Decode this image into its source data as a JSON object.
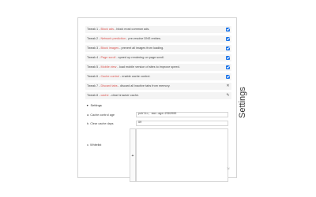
{
  "tweaks": [
    {
      "prefix": "Tweak 1 - ",
      "name": "Block ads",
      "desc": " - block most common ads.",
      "control": "checkbox",
      "checked": true
    },
    {
      "prefix": "Tweak 2 - ",
      "name": "Network prediction",
      "desc": " - pre-resolve DNS entries.",
      "control": "checkbox",
      "checked": true
    },
    {
      "prefix": "Tweak 3 - ",
      "name": "Block images",
      "desc": " - prevent all images from loading.",
      "control": "checkbox",
      "checked": true
    },
    {
      "prefix": "Tweak 4 - ",
      "name": "Page scroll",
      "desc": " - speed up rendering on page scroll.",
      "control": "checkbox",
      "checked": true
    },
    {
      "prefix": "Tweak 5 - ",
      "name": "Mobile view",
      "desc": " - load mobile version of sites to improve speed.",
      "control": "checkbox",
      "checked": true
    },
    {
      "prefix": "Tweak 6 - ",
      "name": "Cache control",
      "desc": " - enable cache control.",
      "control": "checkbox",
      "checked": true
    },
    {
      "prefix": "Tweak 7 - ",
      "name": "Discard tabs",
      "desc": " - discard all inactive tabs from memory.",
      "control": "icon",
      "icon": "x-icon",
      "glyph": "✕"
    },
    {
      "prefix": "Tweak 8 - ",
      "name": "cache",
      "desc": " - clear browser cache.",
      "control": "icon",
      "icon": "broom-icon",
      "glyph": "✎"
    }
  ],
  "settings": {
    "title": "Settings",
    "caret": "▼",
    "cache_age_label": "a. Cache control age",
    "cache_age_value": "public, max-age=2592000",
    "cache_days_label": "b. Clear cache days",
    "cache_days_value": "90",
    "whitelist_label": "c. Whitelist",
    "whitelist_value": "",
    "add_glyph": "+",
    "resize_glyph": "⇲"
  },
  "vertical_title": "Settings",
  "colors": {
    "accent": "#1a73e8",
    "tweak_name": "#d9534f",
    "row_bg": "#f4f4f4"
  }
}
